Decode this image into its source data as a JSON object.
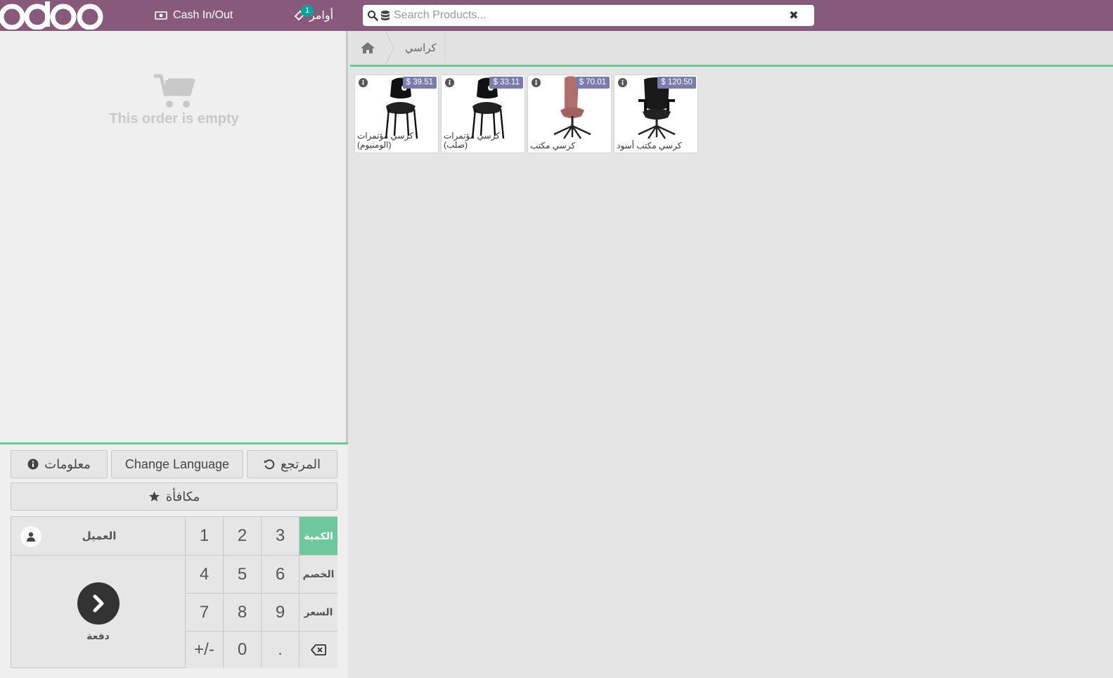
{
  "header": {
    "logo_text": "odoo",
    "cash_label": "Cash In/Out",
    "orders_label": "أوامر",
    "orders_count": "1",
    "search": {
      "placeholder": "Search Products...",
      "value": ""
    }
  },
  "order": {
    "empty_message": "This order is empty"
  },
  "controls": {
    "refund_label": "المرتجع",
    "change_language_label": "Change Language",
    "info_label": "معلومات",
    "reward_label": "مكافأة"
  },
  "numpad": {
    "customer_label": "العميل",
    "payment_label": "دفعة",
    "keys": [
      "1",
      "2",
      "3",
      "4",
      "5",
      "6",
      "7",
      "8",
      "9",
      "+/-",
      "0",
      "."
    ],
    "modes": [
      "الكمية",
      "الخصم",
      "السعر"
    ],
    "active_mode": "الكمية"
  },
  "categories": {
    "current": "كراسي"
  },
  "products": [
    {
      "name": "كرسي مؤتمرات (الومنيوم)",
      "price": "$ 39.51",
      "image": "black-conference-chair"
    },
    {
      "name": "كرسي مؤتمرات (صلب)",
      "price": "$ 33.11",
      "image": "black-conference-chair"
    },
    {
      "name": "كرسي مكتب",
      "price": "$ 70.01",
      "image": "pink-office-chair"
    },
    {
      "name": "كرسي مكتب أسود",
      "price": "$ 120.50",
      "image": "black-office-chair"
    }
  ],
  "colors": {
    "brand": "#875a7b",
    "accent": "#6ec89b",
    "price_badge": "#7c7bad",
    "orders_badge": "#00a09d"
  }
}
